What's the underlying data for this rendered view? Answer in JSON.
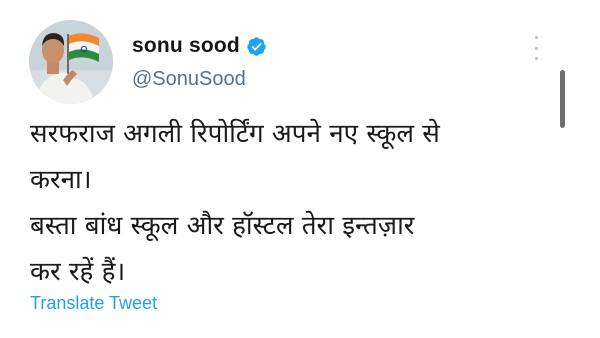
{
  "tweet": {
    "author": {
      "display_name": "sonu sood",
      "handle": "@SonuSood",
      "verified": true,
      "avatar_icon": "profile-photo-with-indian-flag"
    },
    "text_lines": [
      "सरफराज अगली रिपोर्टिंग अपने नए स्कूल से",
      "करना।",
      "बस्ता बांध स्कूल और हॉस्टल तेरा इन्तज़ार",
      "कर रहें हैं।"
    ],
    "translate_label": "Translate Tweet",
    "more_icon": "more-vertical-icon"
  },
  "colors": {
    "link": "#1da1f2",
    "verified_badge": "#1da1f2",
    "handle": "#5b7083",
    "text": "#14171a"
  }
}
